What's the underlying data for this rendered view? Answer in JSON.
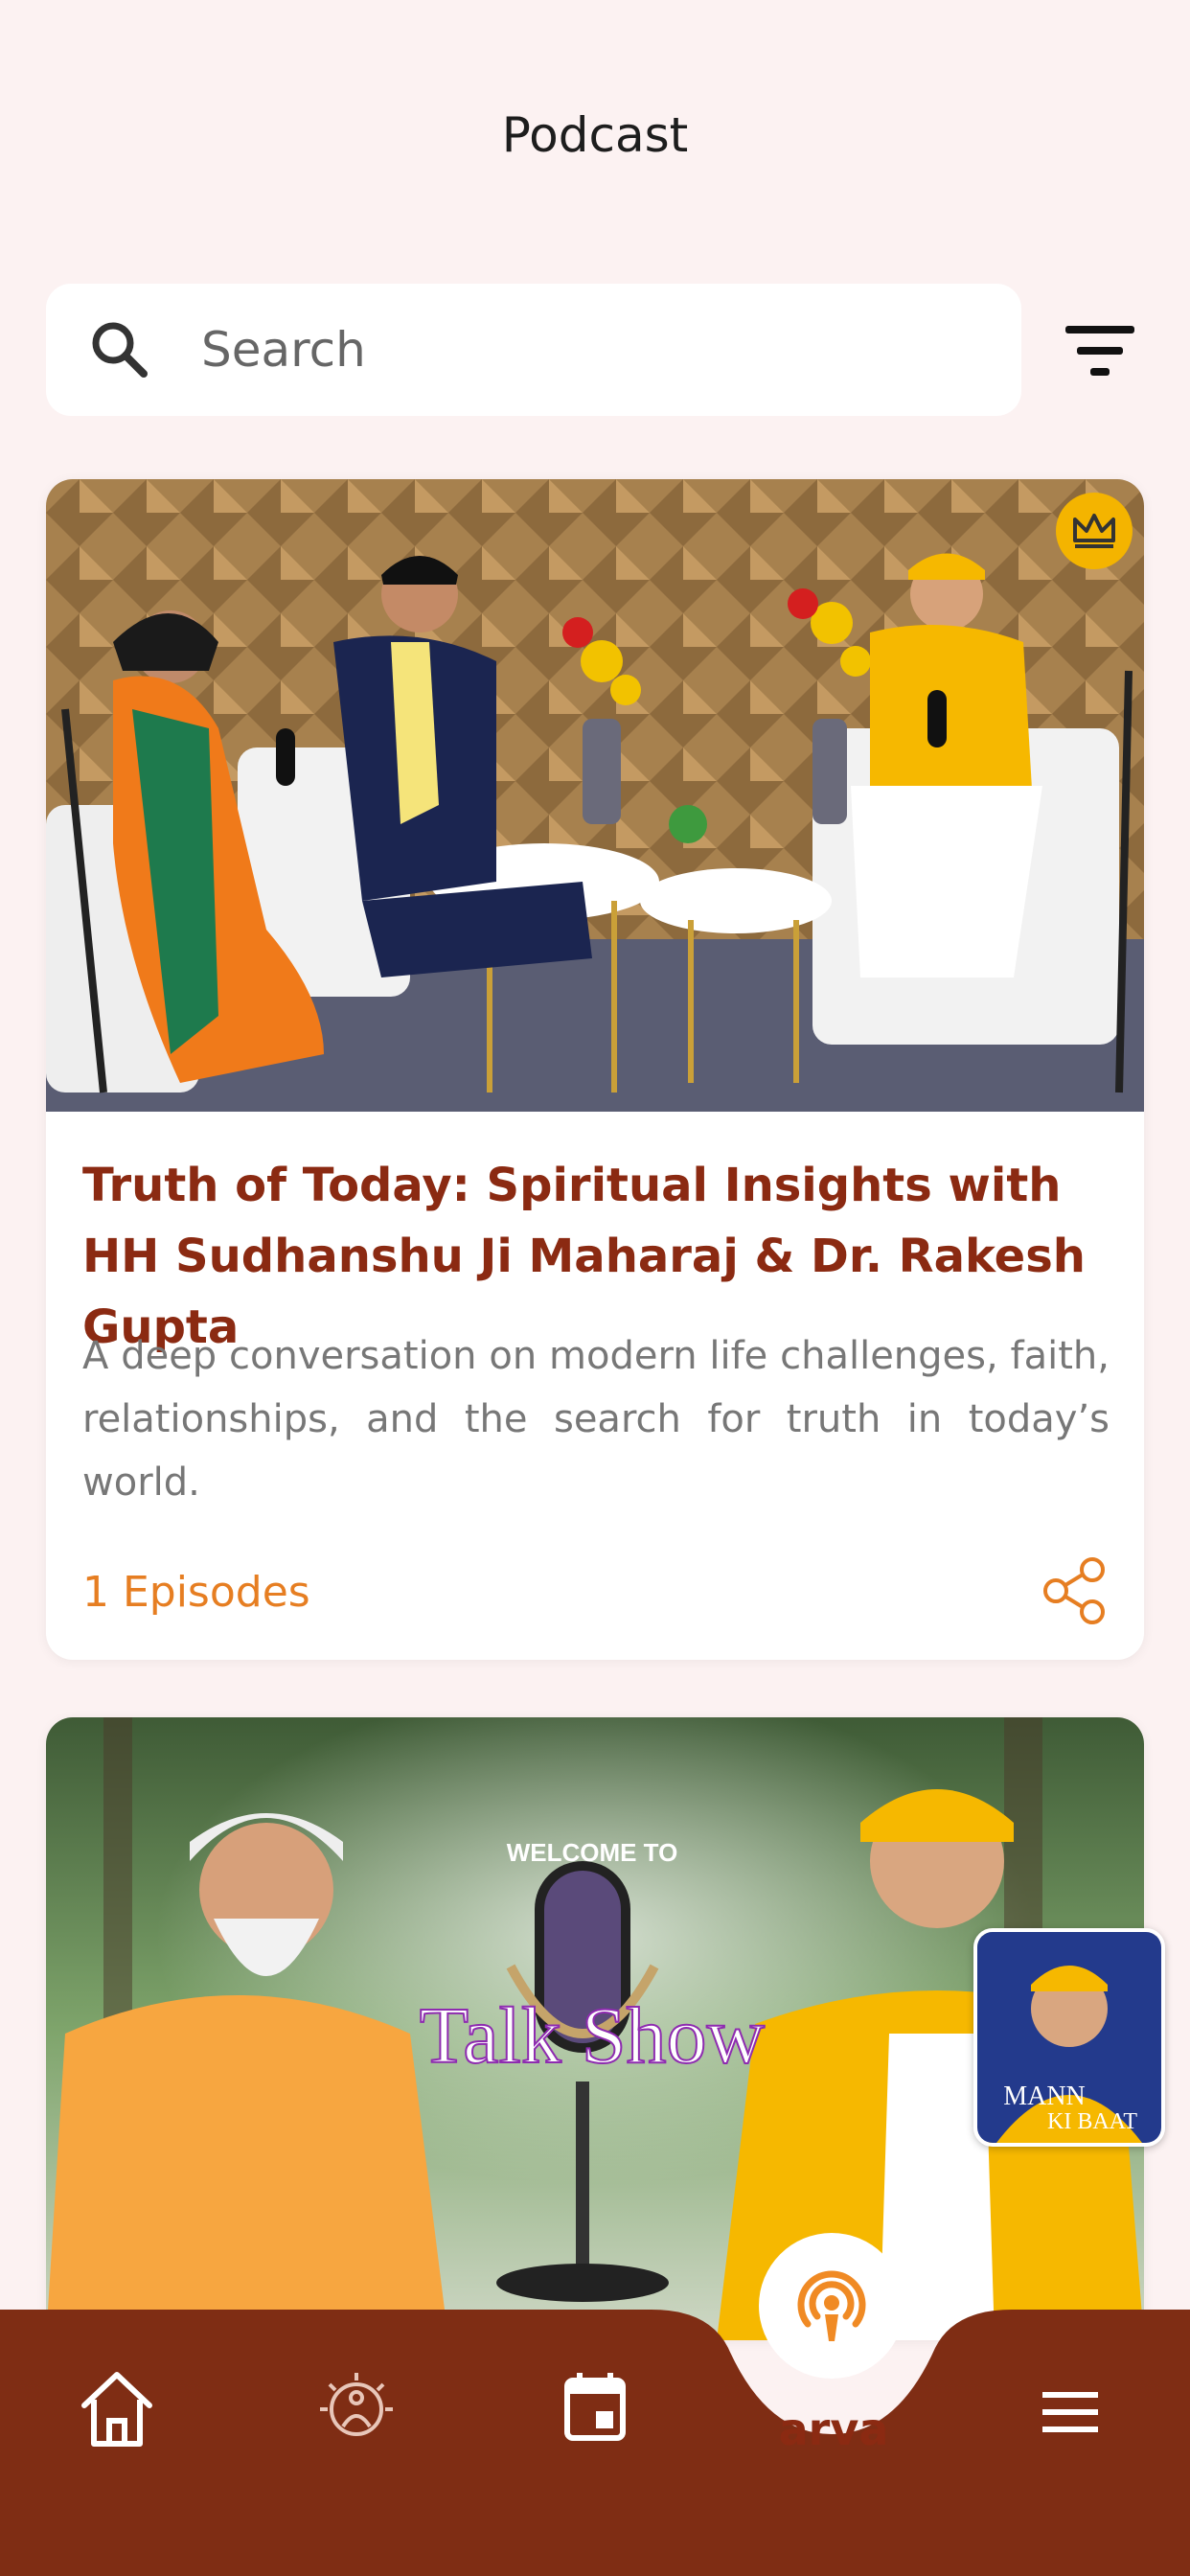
{
  "header": {
    "title": "Podcast"
  },
  "search": {
    "placeholder": "Search"
  },
  "cards": [
    {
      "title": "Truth of Today: Spiritual Insights with HH Sudhanshu Ji Maharaj & Dr. Rakesh Gupta",
      "description": "A deep conversation on modern life challenges, faith, relationships, and the search for truth in today’s world.",
      "episodes": "1 Episodes",
      "premium_badge": "crown-icon"
    },
    {
      "banner_text": "Talk Show",
      "banner_subtext": "WELCOME TO"
    }
  ],
  "floating_player": {
    "label_line1": "MANN",
    "label_line2": "KI BAAT"
  },
  "bottom_nav": {
    "center_label": "arva",
    "items": [
      "home-icon",
      "meditation-icon",
      "calendar-icon",
      "podcast-icon",
      "menu-icon"
    ]
  },
  "colors": {
    "brand_brown": "#7f2d14",
    "accent_orange": "#e67e22",
    "background": "#fcf2f2",
    "crown_gold": "#f4b400"
  }
}
